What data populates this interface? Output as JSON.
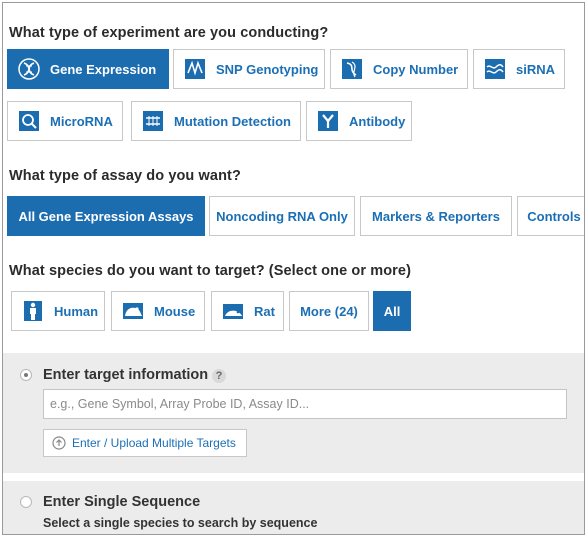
{
  "experiment": {
    "question": "What type of experiment are you conducting?",
    "options": [
      {
        "label": "Gene Expression",
        "icon": "dna-helix-icon",
        "selected": true
      },
      {
        "label": "SNP Genotyping",
        "icon": "snp-icon",
        "selected": false
      },
      {
        "label": "Copy Number",
        "icon": "copy-number-icon",
        "selected": false
      },
      {
        "label": "siRNA",
        "icon": "sirna-icon",
        "selected": false
      },
      {
        "label": "MicroRNA",
        "icon": "microrna-icon",
        "selected": false
      },
      {
        "label": "Mutation Detection",
        "icon": "mutation-icon",
        "selected": false
      },
      {
        "label": "Antibody",
        "icon": "antibody-icon",
        "selected": false
      }
    ]
  },
  "assay": {
    "question": "What type of assay do you want?",
    "options": [
      {
        "label": "All Gene Expression Assays",
        "selected": true
      },
      {
        "label": "Noncoding RNA Only",
        "selected": false
      },
      {
        "label": "Markers & Reporters",
        "selected": false
      },
      {
        "label": "Controls",
        "selected": false
      }
    ]
  },
  "species": {
    "question": "What species do you want to target? (Select one or more)",
    "options": [
      {
        "label": "Human",
        "icon": "human-icon",
        "selected": false
      },
      {
        "label": "Mouse",
        "icon": "mouse-icon",
        "selected": false
      },
      {
        "label": "Rat",
        "icon": "rat-icon",
        "selected": false
      },
      {
        "label": "More (24)",
        "selected": false
      },
      {
        "label": "All",
        "selected": true
      }
    ]
  },
  "target": {
    "title": "Enter target information",
    "help": "?",
    "input_value": "",
    "placeholder": "e.g., Gene Symbol, Array Probe ID, Assay ID...",
    "upload_label": "Enter / Upload Multiple Targets",
    "selected": true
  },
  "sequence": {
    "title": "Enter Single Sequence",
    "subtitle": "Select a single species to search by sequence",
    "selected": false
  },
  "colors": {
    "accent": "#1c6cb0",
    "link": "#1b6fb5",
    "panel": "#ececec"
  }
}
